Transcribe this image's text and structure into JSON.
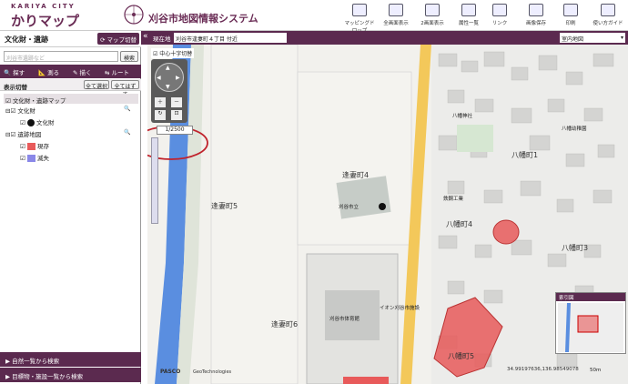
{
  "header": {
    "logo_top": "KARIYA CITY",
    "logo_main": "かりマップ",
    "title": "刈谷市地図情報システム",
    "tools": [
      "マッピングドロップ",
      "全画面表示",
      "2画面表示",
      "属性一覧",
      "リンク",
      "画像保存",
      "印刷",
      "使い方ガイド"
    ]
  },
  "left": {
    "title": "文化財・遺跡",
    "switch_button": "マップ切替",
    "search_placeholder": "刈谷市遺跡など",
    "search_button": "検索",
    "nav": [
      "探す",
      "測る",
      "描く",
      "ルート"
    ],
    "layer_section": "表示切替",
    "select_all": "全て選択",
    "clear_all": "全てはずす",
    "layers": {
      "root": "文化財・遺跡マップ",
      "cultural": "文化財",
      "cultural_child": "文化財",
      "ruins": "遺跡地図",
      "existing": "現存",
      "lost": "滅失"
    },
    "footer": [
      "自然一覧から検索",
      "目標物・施設一覧から検索"
    ]
  },
  "mapbar": {
    "location_label": "現在地",
    "location_value": "刈谷市逢妻町４丁目 付近",
    "map_select": "室内地図"
  },
  "map": {
    "check_label": "中心十字切替",
    "scale": "1/2500",
    "labels": [
      "逢妻町4",
      "逢妻町5",
      "逢妻町6",
      "八幡町1",
      "八幡町3",
      "八幡町4",
      "八幡町5",
      "鉄鋼工業",
      "刈谷市体育館",
      "イオン刈谷市施設",
      "八幡神社",
      "刈谷市立",
      "八幡幼稚園"
    ],
    "overview_title": "索引図",
    "coords": "34.99197636,136.98549078",
    "scale_bar": "50m",
    "credits": [
      "PASCO",
      "GeoTechnologies"
    ]
  },
  "colors": {
    "brand": "#5b2a4f",
    "existing": "#e85a5a",
    "lost": "#8a88e8",
    "road": "#f3c85a",
    "river": "#5a8ee0"
  }
}
